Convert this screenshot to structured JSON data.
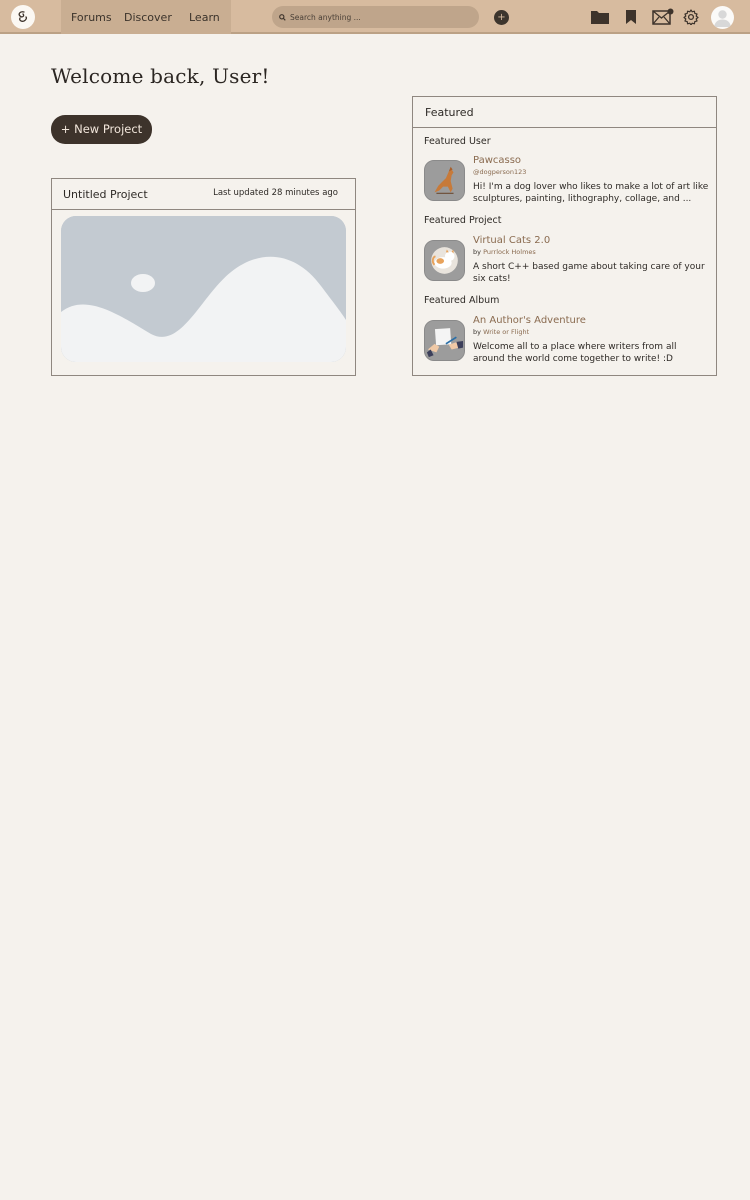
{
  "nav": {
    "forums": "Forums",
    "discover": "Discover",
    "learn": "Learn",
    "search_placeholder": "Search anything ...",
    "create_label": "+"
  },
  "icons": {
    "logo": "swirl-logo-icon",
    "search": "search-icon",
    "folder": "folder-icon",
    "bookmark": "bookmark-icon",
    "mail": "mail-icon",
    "settings": "gear-icon",
    "avatar": "avatar-icon"
  },
  "main": {
    "welcome": "Welcome back, User!",
    "new_project": "+ New Project"
  },
  "project": {
    "title": "Untitled Project",
    "updated": "Last updated 28 minutes ago"
  },
  "featured": {
    "title": "Featured",
    "user": {
      "section": "Featured User",
      "name": "Pawcasso",
      "handle": "@dogperson123",
      "description": "Hi! I'm a dog lover who likes to make a lot of art like sculptures, painting, lithography, collage, and ..."
    },
    "project": {
      "section": "Featured Project",
      "name": "Virtual Cats 2.0",
      "by_prefix": "by",
      "author": "Purrlock Holmes",
      "description": "A short C++ based game about taking care of your six cats!"
    },
    "album": {
      "section": "Featured Album",
      "name": "An Author's Adventure",
      "by_prefix": "by",
      "author": "Write or Flight",
      "description": "Welcome all to a place where writers from all around the world come together to write! :D"
    }
  },
  "colors": {
    "topbar": "#d7bb9f",
    "nav_group": "#c9ae92",
    "background": "#f5f2ed",
    "accent_dark": "#3d332b",
    "link_brown": "#8a6b50"
  }
}
